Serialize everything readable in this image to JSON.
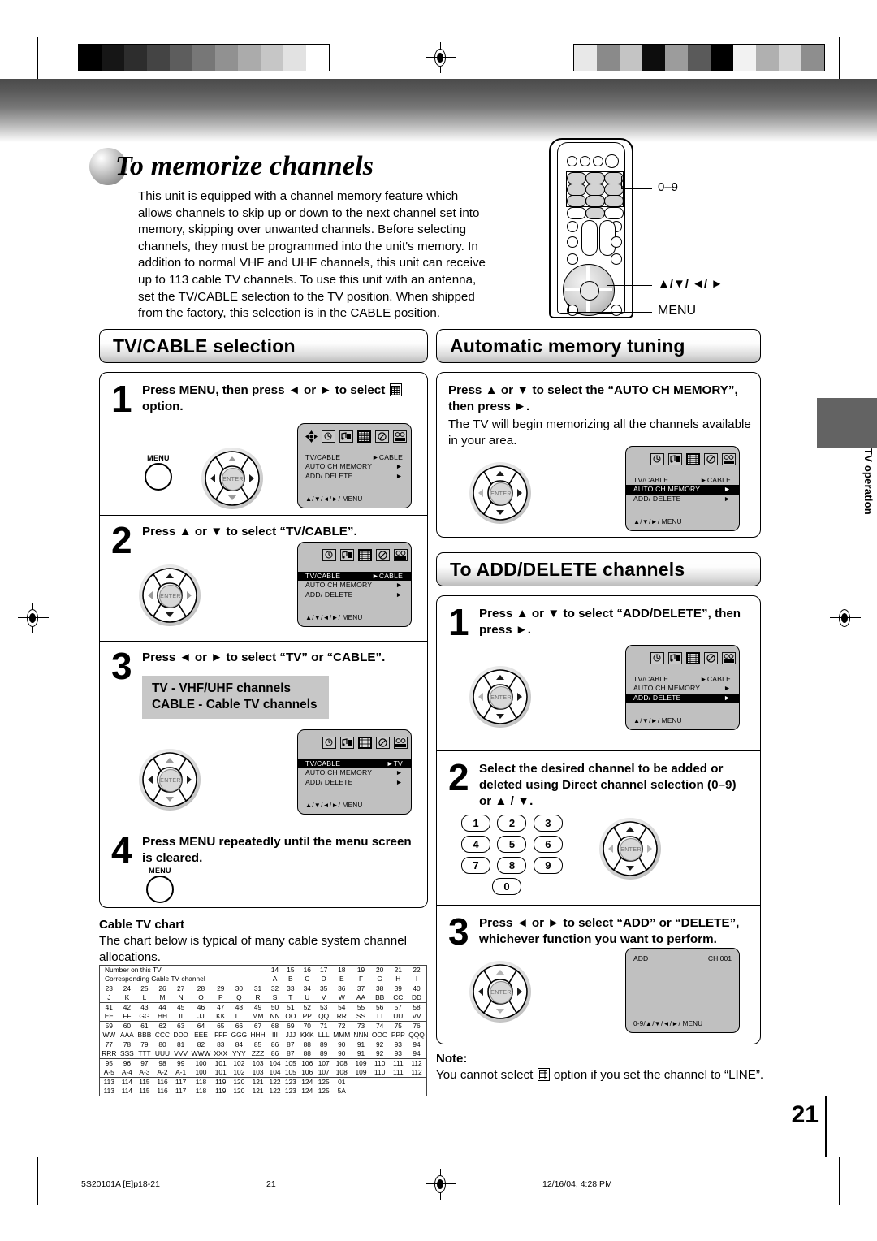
{
  "document": {
    "title": "To memorize channels",
    "page_number": "21",
    "side_tab": "TV operation",
    "footer_left": "5S20101A [E]p18-21",
    "footer_center": "21",
    "footer_right": "12/16/04, 4:28 PM"
  },
  "intro": {
    "body": "This unit is equipped with a channel memory feature which allows channels to skip up or down to the next channel set into memory, skipping over unwanted channels. Before selecting channels, they must be programmed into the unit's memory. In addition to normal VHF and UHF channels, this unit can receive up to 113 cable TV channels. To use this unit with an antenna, set the TV/CABLE selection to the TV position. When shipped from the factory, this selection is in the CABLE position."
  },
  "remote": {
    "callout_numeric": "0–9",
    "callout_arrows": "▲/▼/ ◄/ ►",
    "callout_menu": "MENU"
  },
  "sections": {
    "tv_cable": {
      "heading": "TV/CABLE selection",
      "steps": [
        {
          "num": "1",
          "text": "Press MENU, then press ◄ or ► to select ░ option.",
          "text_before_icon": "Press MENU, then press ◄ or ► to select",
          "text_after_icon": "option."
        },
        {
          "num": "2",
          "text": "Press ▲ or ▼ to select “TV/CABLE”."
        },
        {
          "num": "3",
          "text": "Press ◄ or ► to select “TV” or “CABLE”.",
          "callout_line1": "TV - VHF/UHF channels",
          "callout_line2": "CABLE - Cable TV channels"
        },
        {
          "num": "4",
          "text": "Press MENU repeatedly until the menu screen is cleared."
        }
      ]
    },
    "auto_memory": {
      "heading": "Automatic memory tuning",
      "instruction": "Press ▲ or ▼ to select the “AUTO CH MEMORY”, then press ►.",
      "body": "The TV will begin memorizing all the channels available in your area."
    },
    "add_delete": {
      "heading": "To ADD/DELETE channels",
      "steps": [
        {
          "num": "1",
          "text": "Press ▲ or ▼ to select “ADD/DELETE”, then press ►."
        },
        {
          "num": "2",
          "text": "Select the desired channel to be added or deleted using Direct channel selection (0–9) or ▲ / ▼."
        },
        {
          "num": "3",
          "text": "Press ◄ or ► to select “ADD” or “DELETE”, whichever function you want to perform."
        }
      ],
      "keypad": [
        "1",
        "2",
        "3",
        "4",
        "5",
        "6",
        "7",
        "8",
        "9",
        "0"
      ]
    }
  },
  "note": {
    "heading": "Note:",
    "text_before_icon": "You cannot select",
    "text_after_icon": "option if you set the channel to “LINE”."
  },
  "osd": {
    "menu_rows": [
      "TV/CABLE",
      "AUTO  CH  MEMORY",
      "ADD/ DELETE"
    ],
    "footer_full": "▲/▼/◄/►/ MENU",
    "footer_short": "▲/▼/►/ MENU",
    "footer_add": "0-9/▲/▼/◄/►/ MENU",
    "screens": {
      "step1": {
        "values": [
          "►CABLE",
          "►",
          "►"
        ],
        "highlight": -1,
        "footer": "▲/▼/◄/►/ MENU",
        "has_cursor": true
      },
      "step2": {
        "values": [
          "►CABLE",
          "►",
          "►"
        ],
        "highlight": 0,
        "footer": "▲/▼/◄/►/ MENU",
        "has_cursor": false
      },
      "step3": {
        "values": [
          "►TV",
          "►",
          "►"
        ],
        "highlight": 0,
        "footer": "▲/▼/◄/►/ MENU",
        "has_cursor": false
      },
      "auto": {
        "values": [
          "►CABLE",
          "►",
          "►"
        ],
        "highlight": 1,
        "footer": "▲/▼/►/ MENU",
        "has_cursor": false
      },
      "adddel": {
        "values": [
          "►CABLE",
          "►",
          "►"
        ],
        "highlight": 2,
        "footer": "▲/▼/►/ MENU",
        "has_cursor": false
      }
    },
    "add_screen": {
      "left": "ADD",
      "right": "CH 001",
      "footer": "0-9/▲/▼/◄/►/ MENU"
    },
    "icon_names": [
      "clock-icon",
      "audio-icon",
      "channel-grid-icon",
      "prohibited-icon",
      "vcr-icon"
    ]
  },
  "cable_chart": {
    "heading": "Cable TV chart",
    "description": "The chart below is typical of many cable system channel allocations.",
    "row_label_1": "Number on this TV",
    "row_label_2": "Corresponding Cable TV channel",
    "rows": [
      {
        "tv": [
          "",
          "",
          "",
          "",
          "",
          "",
          "",
          "",
          "",
          "14",
          "15",
          "16",
          "17",
          "18",
          "19",
          "20",
          "21",
          "22"
        ],
        "cable": [
          "",
          "",
          "",
          "",
          "",
          "",
          "",
          "",
          "",
          "A",
          "B",
          "C",
          "D",
          "E",
          "F",
          "G",
          "H",
          "I"
        ]
      },
      {
        "tv": [
          "23",
          "24",
          "25",
          "26",
          "27",
          "28",
          "29",
          "30",
          "31",
          "32",
          "33",
          "34",
          "35",
          "36",
          "37",
          "38",
          "39",
          "40"
        ],
        "cable": [
          "J",
          "K",
          "L",
          "M",
          "N",
          "O",
          "P",
          "Q",
          "R",
          "S",
          "T",
          "U",
          "V",
          "W",
          "AA",
          "BB",
          "CC",
          "DD"
        ]
      },
      {
        "tv": [
          "41",
          "42",
          "43",
          "44",
          "45",
          "46",
          "47",
          "48",
          "49",
          "50",
          "51",
          "52",
          "53",
          "54",
          "55",
          "56",
          "57",
          "58"
        ],
        "cable": [
          "EE",
          "FF",
          "GG",
          "HH",
          "II",
          "JJ",
          "KK",
          "LL",
          "MM",
          "NN",
          "OO",
          "PP",
          "QQ",
          "RR",
          "SS",
          "TT",
          "UU",
          "VV"
        ]
      },
      {
        "tv": [
          "59",
          "60",
          "61",
          "62",
          "63",
          "64",
          "65",
          "66",
          "67",
          "68",
          "69",
          "70",
          "71",
          "72",
          "73",
          "74",
          "75",
          "76"
        ],
        "cable": [
          "WW",
          "AAA",
          "BBB",
          "CCC",
          "DDD",
          "EEE",
          "FFF",
          "GGG",
          "HHH",
          "III",
          "JJJ",
          "KKK",
          "LLL",
          "MMM",
          "NNN",
          "OOO",
          "PPP",
          "QQQ"
        ]
      },
      {
        "tv": [
          "77",
          "78",
          "79",
          "80",
          "81",
          "82",
          "83",
          "84",
          "85",
          "86",
          "87",
          "88",
          "89",
          "90",
          "91",
          "92",
          "93",
          "94"
        ],
        "cable": [
          "RRR",
          "SSS",
          "TTT",
          "UUU",
          "VVV",
          "WWW",
          "XXX",
          "YYY",
          "ZZZ",
          "86",
          "87",
          "88",
          "89",
          "90",
          "91",
          "92",
          "93",
          "94"
        ]
      },
      {
        "tv": [
          "95",
          "96",
          "97",
          "98",
          "99",
          "100",
          "101",
          "102",
          "103",
          "104",
          "105",
          "106",
          "107",
          "108",
          "109",
          "110",
          "111",
          "112"
        ],
        "cable": [
          "A-5",
          "A-4",
          "A-3",
          "A-2",
          "A-1",
          "100",
          "101",
          "102",
          "103",
          "104",
          "105",
          "106",
          "107",
          "108",
          "109",
          "110",
          "111",
          "112"
        ]
      },
      {
        "tv": [
          "113",
          "114",
          "115",
          "116",
          "117",
          "118",
          "119",
          "120",
          "121",
          "122",
          "123",
          "124",
          "125",
          "01",
          "",
          "",
          "",
          ""
        ],
        "cable": [
          "113",
          "114",
          "115",
          "116",
          "117",
          "118",
          "119",
          "120",
          "121",
          "122",
          "123",
          "124",
          "125",
          "5A",
          "",
          "",
          "",
          ""
        ]
      }
    ]
  }
}
